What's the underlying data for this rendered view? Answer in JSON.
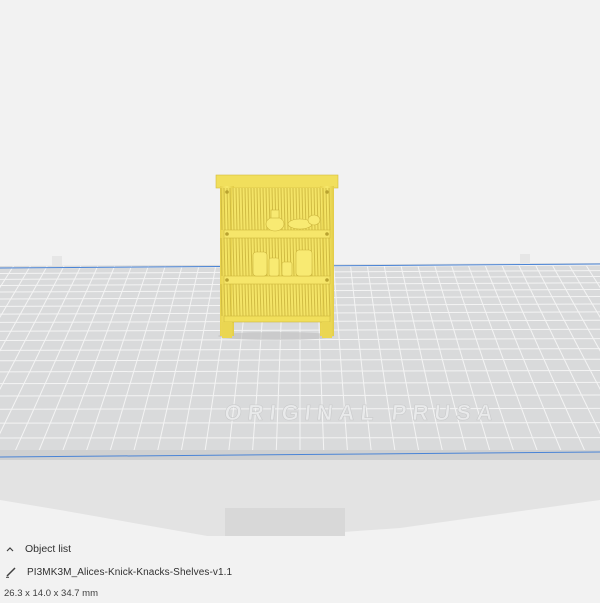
{
  "viewport": {
    "bed_label": "ORIGINAL PRUSA",
    "colors": {
      "background": "#f2f2f2",
      "bed_surface": "#d9dadb",
      "bed_grid": "#f6f6f6",
      "bed_edge_line": "#4a84d6",
      "model_fill": "#f2e163",
      "model_shadow": "#c9b33a"
    }
  },
  "object_panel": {
    "header_label": "Object list",
    "header_icon": "chevron-up-icon",
    "object": {
      "icon": "pencil-icon",
      "name": "PI3MK3M_Alices-Knick-Knacks-Shelves-v1.1",
      "dimensions": "26.3 x 14.0 x 34.7 mm"
    }
  }
}
